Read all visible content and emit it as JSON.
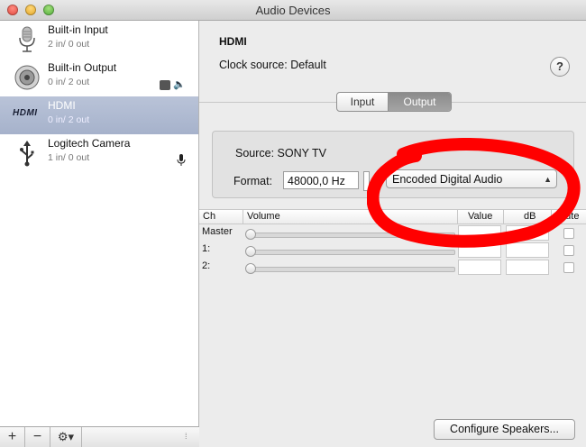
{
  "window": {
    "title": "Audio Devices"
  },
  "devices": [
    {
      "name": "Built-in Input",
      "io": "2 in/ 0 out",
      "icon": "microphone-icon",
      "selected": false
    },
    {
      "name": "Built-in Output",
      "io": "0 in/ 2 out",
      "icon": "speaker-icon",
      "selected": false,
      "badges": [
        "finder-icon",
        "volume-icon"
      ]
    },
    {
      "name": "HDMI",
      "io": "0 in/ 2 out",
      "icon": "hdmi-logo",
      "logo_text": "HDMI",
      "selected": true
    },
    {
      "name": "Logitech Camera",
      "io": "1 in/ 0 out",
      "icon": "usb-icon",
      "selected": false,
      "badges": [
        "microphone-icon"
      ]
    }
  ],
  "bottombar": {
    "add": "+",
    "remove": "−",
    "gear": "⚙▾"
  },
  "detail": {
    "device_name": "HDMI",
    "clock_source": "Clock source:  Default",
    "help": "?",
    "tabs": [
      "Input",
      "Output"
    ],
    "active_tab": "Output",
    "source": "Source:  SONY TV",
    "format_label": "Format:",
    "format_value": "48000,0 Hz",
    "format_popup": "Encoded Digital Audio"
  },
  "table": {
    "headers": {
      "ch": "Ch",
      "volume": "Volume",
      "value": "Value",
      "db": "dB",
      "mute": "Mute"
    },
    "rows": [
      "Master",
      "1:",
      "2:"
    ]
  },
  "configure_button": "Configure Speakers...",
  "annotation_color": "#ff0000"
}
